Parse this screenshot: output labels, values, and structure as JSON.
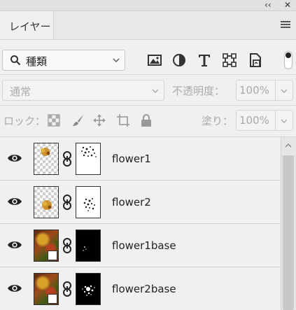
{
  "window": {
    "collapse_label": "‹‹",
    "close_label": "✕"
  },
  "panel": {
    "tab_label": "レイヤー",
    "menu_icon": "hamburger-menu-icon"
  },
  "filter": {
    "kind_value": "種類",
    "icons": [
      "image-filter-icon",
      "adjustment-filter-icon",
      "type-filter-icon",
      "shape-filter-icon",
      "smart-object-filter-icon"
    ]
  },
  "blend": {
    "mode_value": "通常",
    "opacity_label": "不透明度：",
    "opacity_value": "100%"
  },
  "lock": {
    "label": "ロック：",
    "icons": [
      "lock-transparent-pixels-icon",
      "lock-image-pixels-icon",
      "lock-position-icon",
      "lock-artboard-icon",
      "lock-all-icon"
    ],
    "fill_label": "塗り：",
    "fill_value": "100%"
  },
  "layers": [
    {
      "name": "flower1",
      "thumb": "transparent",
      "visible": true
    },
    {
      "name": "flower2",
      "thumb": "transparent",
      "visible": true
    },
    {
      "name": "flower1base",
      "thumb": "smart-object",
      "visible": true
    },
    {
      "name": "flower2base",
      "thumb": "smart-object",
      "visible": true
    }
  ]
}
